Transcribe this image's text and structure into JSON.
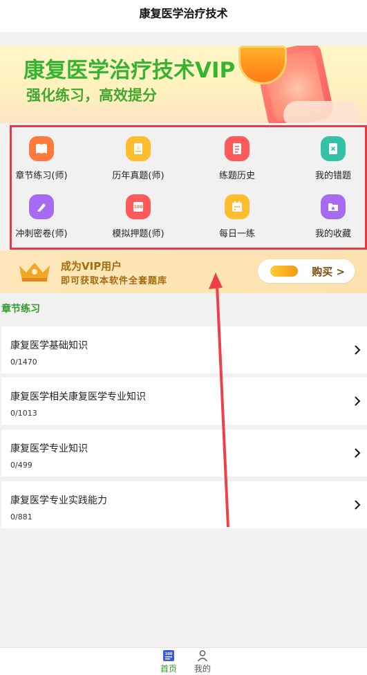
{
  "header": {
    "title": "康复医学治疗技术"
  },
  "banner": {
    "title": "康复医学治疗技术VIP",
    "subtitle": "强化练习，高效提分"
  },
  "grid": [
    {
      "label": "章节练习(师)",
      "icon": "book-open-icon",
      "color": "#ff7a3c"
    },
    {
      "label": "历年真题(师)",
      "icon": "exam-paper-icon",
      "color": "#ffbe2e"
    },
    {
      "label": "练题历史",
      "icon": "history-notes-icon",
      "color": "#ff5959"
    },
    {
      "label": "我的错题",
      "icon": "wrong-notebook-icon",
      "color": "#33c2a8"
    },
    {
      "label": "冲刺密卷(师)",
      "icon": "pen-sprint-icon",
      "color": "#a66bf2"
    },
    {
      "label": "模拟押题(师)",
      "icon": "score-100-icon",
      "color": "#ff5959"
    },
    {
      "label": "每日一练",
      "icon": "calendar-icon",
      "color": "#ffbe2e"
    },
    {
      "label": "我的收藏",
      "icon": "star-folder-icon",
      "color": "#a66bf2"
    }
  ],
  "vip": {
    "title": "成为VIP用户",
    "subtitle": "即可获取本软件全套题库",
    "buy_label": "购买 >"
  },
  "section_title": "章节练习",
  "chapters": [
    {
      "title": "康复医学基础知识",
      "count": "0/1470"
    },
    {
      "title": "康复医学相关康复医学专业知识",
      "count": "0/1013"
    },
    {
      "title": "康复医学专业知识",
      "count": "0/499"
    },
    {
      "title": "康复医学专业实践能力",
      "count": "0/881"
    }
  ],
  "tabs": [
    {
      "label": "首页",
      "icon": "home-100-icon",
      "color": "#2e9a28"
    },
    {
      "label": "我的",
      "icon": "user-icon",
      "color": "#555555"
    }
  ],
  "colors": {
    "accent_green": "#2e9a28",
    "highlight_red": "#e43a48"
  }
}
